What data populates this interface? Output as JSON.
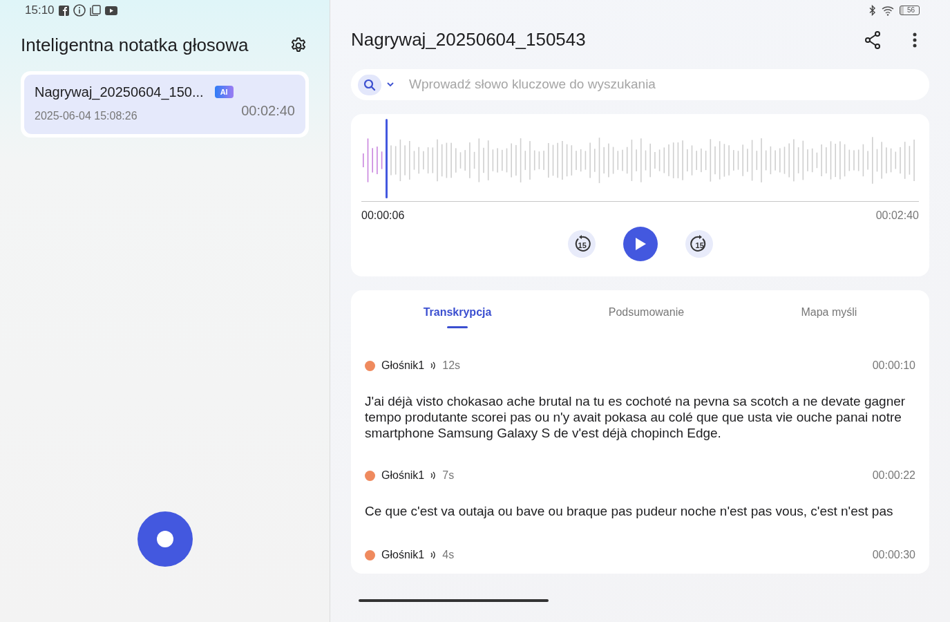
{
  "status_bar": {
    "time": "15:10",
    "battery": "56"
  },
  "sidebar": {
    "title": "Inteligentna notatka głosowa",
    "recordings": [
      {
        "name": "Nagrywaj_20250604_150...",
        "badge": "AI",
        "date": "2025-06-04 15:08:26",
        "duration": "00:02:40",
        "selected": true
      }
    ]
  },
  "header": {
    "title": "Nagrywaj_20250604_150543"
  },
  "search": {
    "placeholder": "Wprowadź słowo kluczowe do wyszukania"
  },
  "player": {
    "level": 0.043,
    "elapsed": "00:00:06",
    "total": "00:02:40",
    "rewind_label": "15",
    "forward_label": "15"
  },
  "tabs": [
    {
      "label": "Transkrypcja",
      "selected": true
    },
    {
      "label": "Podsumowanie",
      "selected": false
    },
    {
      "label": "Mapa myśli",
      "selected": false
    }
  ],
  "segments": [
    {
      "speaker": "Głośnik1",
      "length": "12s",
      "time": "00:00:10",
      "text": "J'ai déjà visto chokasao ache brutal na tu es cochoté na pevna sa scotch a ne devate gagner tempo produtante scorei pas ou n'y avait pokasa au colé que que usta vie ouche panai notre smartphone Samsung Galaxy S de v'est déjà chopinch Edge."
    },
    {
      "speaker": "Głośnik1",
      "length": "7s",
      "time": "00:00:22",
      "text": "Ce que c'est va outaja ou bave ou braque pas pudeur noche n'est pas vous, c'est n'est pas"
    },
    {
      "speaker": "Głośnik1",
      "length": "4s",
      "time": "00:00:30"
    }
  ]
}
